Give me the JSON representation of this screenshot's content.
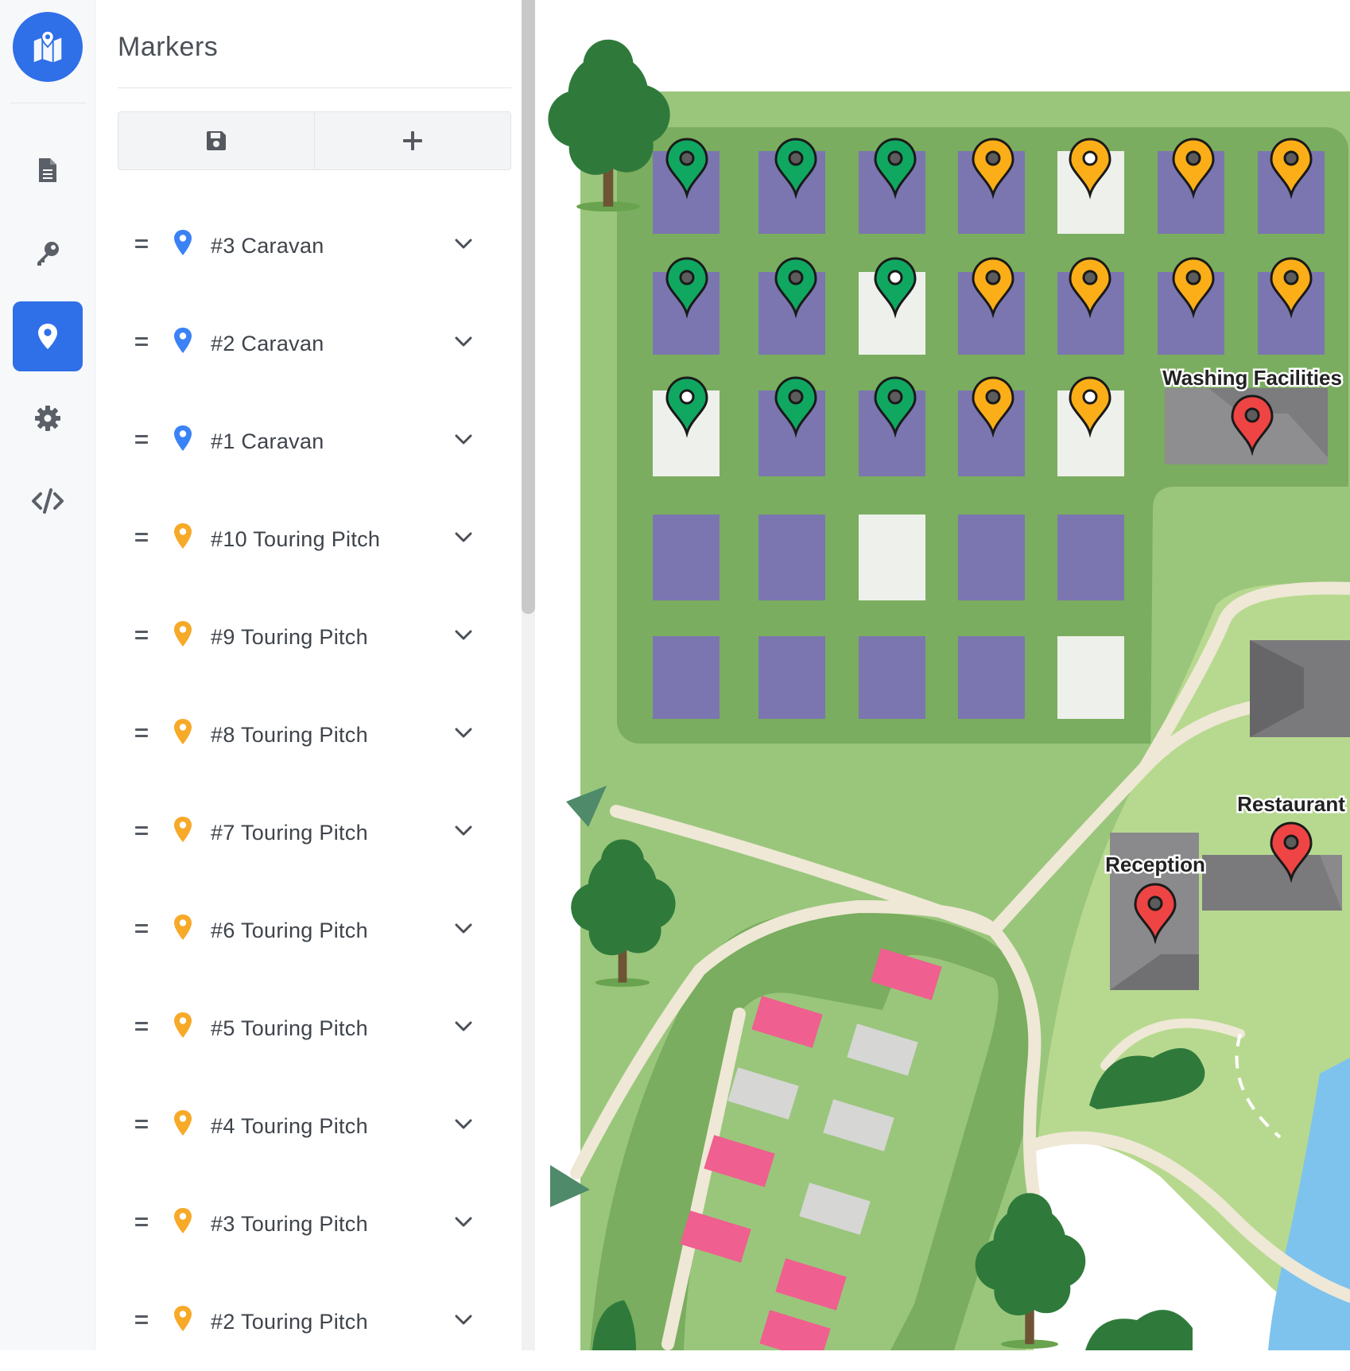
{
  "sidebar": {
    "icons": [
      "map-logo-icon",
      "document-icon",
      "key-icon",
      "map-pin-icon",
      "gear-icon",
      "code-icon"
    ],
    "active": "map-pin-icon"
  },
  "panel": {
    "title": "Markers",
    "toolbar": {
      "save_icon": "floppy-disk-icon",
      "add_icon": "plus-icon"
    },
    "items": [
      {
        "label": "#3 Caravan",
        "pin_color": "#3b82f6"
      },
      {
        "label": "#2 Caravan",
        "pin_color": "#3b82f6"
      },
      {
        "label": "#1 Caravan",
        "pin_color": "#3b82f6"
      },
      {
        "label": "#10 Touring Pitch",
        "pin_color": "#f7a928"
      },
      {
        "label": "#9 Touring Pitch",
        "pin_color": "#f7a928"
      },
      {
        "label": "#8 Touring Pitch",
        "pin_color": "#f7a928"
      },
      {
        "label": "#7 Touring Pitch",
        "pin_color": "#f7a928"
      },
      {
        "label": "#6 Touring Pitch",
        "pin_color": "#f7a928"
      },
      {
        "label": "#5 Touring Pitch",
        "pin_color": "#f7a928"
      },
      {
        "label": "#4 Touring Pitch",
        "pin_color": "#f7a928"
      },
      {
        "label": "#3 Touring Pitch",
        "pin_color": "#f7a928"
      },
      {
        "label": "#2 Touring Pitch",
        "pin_color": "#f7a928"
      }
    ]
  },
  "map": {
    "labels": {
      "washing": "Washing Facilities",
      "restaurant": "Restaurant",
      "reception": "Reception"
    },
    "colors": {
      "grass": "#9ac67c",
      "grass_dark": "#7aad5f",
      "pitch": "#7b76b0",
      "pitch_empty": "#eef0ec",
      "marker_green": "#10a861",
      "marker_orange": "#fbae17",
      "marker_red": "#ef4444",
      "caravan_pink": "#ef5f8f"
    }
  }
}
